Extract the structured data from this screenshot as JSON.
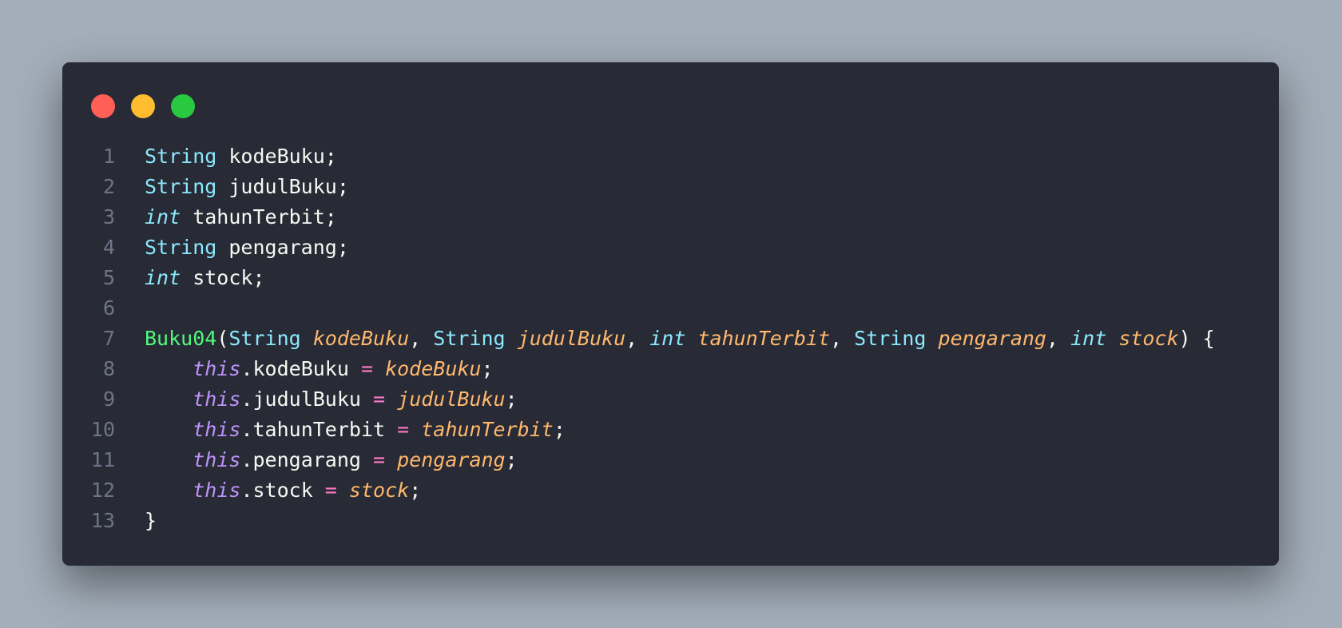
{
  "colors": {
    "background": "#a3aeba",
    "editor_bg": "#282a36",
    "close": "#ff5f57",
    "minimize": "#febc2e",
    "maximize": "#28c840",
    "line_number": "#6f7587",
    "plain": "#f8f8f2",
    "type": "#8be9fd",
    "param": "#ffb86c",
    "this": "#bd93f9",
    "operator": "#ff79c6",
    "function": "#50fa7b"
  },
  "window_controls": [
    {
      "name": "close-button",
      "color": "#ff5f57"
    },
    {
      "name": "minimize-button",
      "color": "#febc2e"
    },
    {
      "name": "maximize-button",
      "color": "#28c840"
    }
  ],
  "code": {
    "lines": [
      {
        "number": "1",
        "tokens": [
          {
            "t": "String",
            "c": "type"
          },
          {
            "t": " kodeBuku;",
            "c": "plain"
          }
        ]
      },
      {
        "number": "2",
        "tokens": [
          {
            "t": "String",
            "c": "type"
          },
          {
            "t": " judulBuku;",
            "c": "plain"
          }
        ]
      },
      {
        "number": "3",
        "tokens": [
          {
            "t": "int",
            "c": "type",
            "i": true
          },
          {
            "t": " tahunTerbit;",
            "c": "plain"
          }
        ]
      },
      {
        "number": "4",
        "tokens": [
          {
            "t": "String",
            "c": "type"
          },
          {
            "t": " pengarang;",
            "c": "plain"
          }
        ]
      },
      {
        "number": "5",
        "tokens": [
          {
            "t": "int",
            "c": "type",
            "i": true
          },
          {
            "t": " stock;",
            "c": "plain"
          }
        ]
      },
      {
        "number": "6",
        "tokens": []
      },
      {
        "number": "7",
        "tokens": [
          {
            "t": "Buku04",
            "c": "function"
          },
          {
            "t": "(",
            "c": "plain"
          },
          {
            "t": "String",
            "c": "type"
          },
          {
            "t": " ",
            "c": "plain"
          },
          {
            "t": "kodeBuku",
            "c": "param",
            "i": true
          },
          {
            "t": ", ",
            "c": "plain"
          },
          {
            "t": "String",
            "c": "type"
          },
          {
            "t": " ",
            "c": "plain"
          },
          {
            "t": "judulBuku",
            "c": "param",
            "i": true
          },
          {
            "t": ", ",
            "c": "plain"
          },
          {
            "t": "int",
            "c": "type",
            "i": true
          },
          {
            "t": " ",
            "c": "plain"
          },
          {
            "t": "tahunTerbit",
            "c": "param",
            "i": true
          },
          {
            "t": ", ",
            "c": "plain"
          },
          {
            "t": "String",
            "c": "type"
          },
          {
            "t": " ",
            "c": "plain"
          },
          {
            "t": "pengarang",
            "c": "param",
            "i": true
          },
          {
            "t": ", ",
            "c": "plain"
          },
          {
            "t": "int",
            "c": "type",
            "i": true
          },
          {
            "t": " ",
            "c": "plain"
          },
          {
            "t": "stock",
            "c": "param",
            "i": true
          },
          {
            "t": ") {",
            "c": "plain"
          }
        ]
      },
      {
        "number": "8",
        "tokens": [
          {
            "t": "    ",
            "c": "plain"
          },
          {
            "t": "this",
            "c": "this",
            "i": true
          },
          {
            "t": ".kodeBuku ",
            "c": "plain"
          },
          {
            "t": "=",
            "c": "operator"
          },
          {
            "t": " ",
            "c": "plain"
          },
          {
            "t": "kodeBuku",
            "c": "param",
            "i": true
          },
          {
            "t": ";",
            "c": "plain"
          }
        ]
      },
      {
        "number": "9",
        "tokens": [
          {
            "t": "    ",
            "c": "plain"
          },
          {
            "t": "this",
            "c": "this",
            "i": true
          },
          {
            "t": ".judulBuku ",
            "c": "plain"
          },
          {
            "t": "=",
            "c": "operator"
          },
          {
            "t": " ",
            "c": "plain"
          },
          {
            "t": "judulBuku",
            "c": "param",
            "i": true
          },
          {
            "t": ";",
            "c": "plain"
          }
        ]
      },
      {
        "number": "10",
        "tokens": [
          {
            "t": "    ",
            "c": "plain"
          },
          {
            "t": "this",
            "c": "this",
            "i": true
          },
          {
            "t": ".tahunTerbit ",
            "c": "plain"
          },
          {
            "t": "=",
            "c": "operator"
          },
          {
            "t": " ",
            "c": "plain"
          },
          {
            "t": "tahunTerbit",
            "c": "param",
            "i": true
          },
          {
            "t": ";",
            "c": "plain"
          }
        ]
      },
      {
        "number": "11",
        "tokens": [
          {
            "t": "    ",
            "c": "plain"
          },
          {
            "t": "this",
            "c": "this",
            "i": true
          },
          {
            "t": ".pengarang ",
            "c": "plain"
          },
          {
            "t": "=",
            "c": "operator"
          },
          {
            "t": " ",
            "c": "plain"
          },
          {
            "t": "pengarang",
            "c": "param",
            "i": true
          },
          {
            "t": ";",
            "c": "plain"
          }
        ]
      },
      {
        "number": "12",
        "tokens": [
          {
            "t": "    ",
            "c": "plain"
          },
          {
            "t": "this",
            "c": "this",
            "i": true
          },
          {
            "t": ".stock ",
            "c": "plain"
          },
          {
            "t": "=",
            "c": "operator"
          },
          {
            "t": " ",
            "c": "plain"
          },
          {
            "t": "stock",
            "c": "param",
            "i": true
          },
          {
            "t": ";",
            "c": "plain"
          }
        ]
      },
      {
        "number": "13",
        "tokens": [
          {
            "t": "}",
            "c": "plain"
          }
        ]
      }
    ]
  }
}
